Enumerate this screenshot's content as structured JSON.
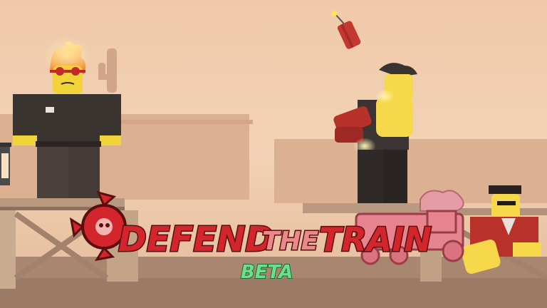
{
  "logo": {
    "line1_word1": "DEFEND",
    "line1_word2": "THE",
    "line1_word3": "TRAIN",
    "badge": "BETA"
  },
  "colors": {
    "sky_top": "#eec7a7",
    "sky_haze": "#f3d8bf",
    "ground": "#a88670",
    "logo_red": "#d3262c",
    "logo_dark": "#5a0e10",
    "logo_pink": "#e98a8a",
    "beta_green": "#6be08a",
    "train_pink": "#e59ca4"
  },
  "characters": [
    {
      "id": "fire-head-guard",
      "icon": "flaming-head-character"
    },
    {
      "id": "dynamite-thrower",
      "icon": "cowboy-character"
    },
    {
      "id": "train-conductor",
      "icon": "conductor-character"
    }
  ],
  "props": [
    {
      "id": "dynamite",
      "icon": "dynamite-icon"
    },
    {
      "id": "lantern",
      "icon": "lantern-icon"
    },
    {
      "id": "cactus",
      "icon": "cactus-icon"
    },
    {
      "id": "logo-gear",
      "icon": "gear-skull-icon"
    },
    {
      "id": "logo-train",
      "icon": "train-icon"
    }
  ]
}
